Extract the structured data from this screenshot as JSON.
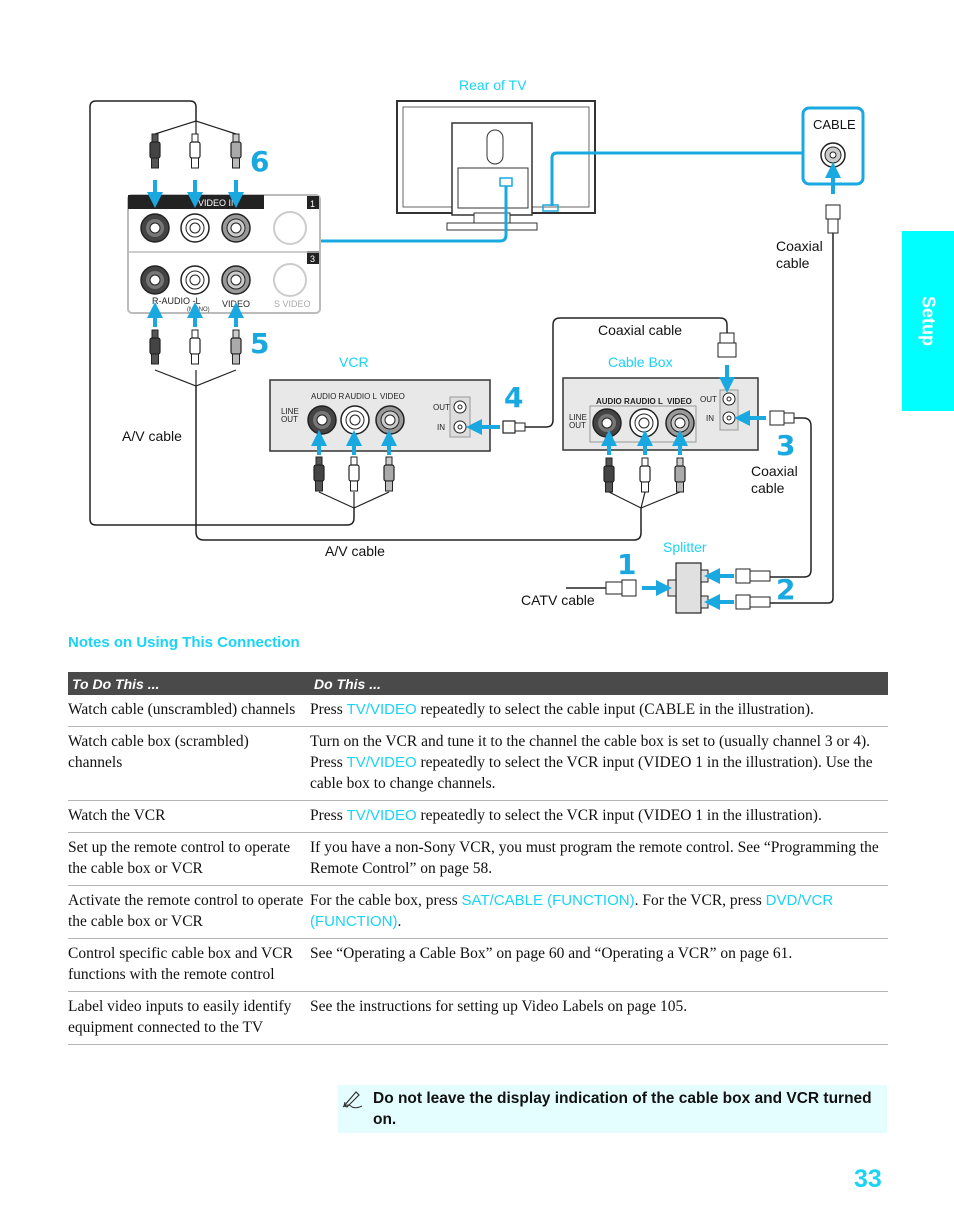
{
  "side_tab": {
    "label": "Setup"
  },
  "diagram": {
    "labels": {
      "rear_of_tv": "Rear of TV",
      "cable_jack": "CABLE",
      "coaxial_cable_top": "Coaxial cable",
      "coaxial_cable_mid": "Coaxial cable",
      "coaxial_cable_right": "Coaxial cable",
      "vcr": "VCR",
      "cable_box": "Cable Box",
      "av_cable_left": "A/V cable",
      "av_cable_bottom": "A/V cable",
      "splitter": "Splitter",
      "catv_cable": "CATV cable"
    },
    "tv_panel": {
      "video_in": "VIDEO IN",
      "input_1": "1",
      "input_3": "3",
      "r_audio_l": "R-AUDIO -L",
      "mono": "(MONO)",
      "video": "VIDEO",
      "s_video": "S VIDEO"
    },
    "vcr_panel": {
      "line_out": [
        "LINE",
        "OUT"
      ],
      "audio_r": "AUDIO R",
      "audio_l": "AUDIO L",
      "video": "VIDEO",
      "out": "OUT",
      "in": "IN"
    },
    "cablebox_panel": {
      "line_out": [
        "LINE",
        "OUT"
      ],
      "audio_r": "AUDIO R",
      "audio_l": "AUDIO L",
      "video": "VIDEO",
      "out": "OUT",
      "in": "IN"
    },
    "steps": [
      "1",
      "2",
      "3",
      "4",
      "5",
      "6"
    ]
  },
  "notes": {
    "title": "Notes on Using This Connection",
    "headers": [
      "To Do This ...",
      "Do This ..."
    ],
    "rows": [
      {
        "task": "Watch cable (unscrambled) channels",
        "action": [
          {
            "t": "Press "
          },
          {
            "t": "TV/VIDEO",
            "kw": true
          },
          {
            "t": " repeatedly to select the cable input (CABLE in the illustration)."
          }
        ]
      },
      {
        "task": "Watch cable box (scrambled) channels",
        "action": [
          {
            "t": "Turn on the VCR and tune it to the channel the cable box is set to (usually channel 3 or 4). Press "
          },
          {
            "t": "TV/VIDEO",
            "kw": true
          },
          {
            "t": " repeatedly to select the VCR input (VIDEO 1 in the illustration). Use the cable box to change channels."
          }
        ]
      },
      {
        "task": "Watch the VCR",
        "action": [
          {
            "t": "Press "
          },
          {
            "t": "TV/VIDEO",
            "kw": true
          },
          {
            "t": " repeatedly to select the VCR input (VIDEO 1 in the illustration)."
          }
        ]
      },
      {
        "task": "Set up the remote control to operate the cable box or VCR",
        "action": [
          {
            "t": "If you have a non-Sony VCR, you must program the remote control. See “Programming the Remote Control” on page 58."
          }
        ]
      },
      {
        "task": "Activate the remote control to operate the cable box or VCR",
        "action": [
          {
            "t": "For the cable box, press "
          },
          {
            "t": "SAT/CABLE (FUNCTION)",
            "kw": true
          },
          {
            "t": ". For the VCR, press "
          },
          {
            "t": "DVD/VCR (FUNCTION)",
            "kw": true
          },
          {
            "t": "."
          }
        ]
      },
      {
        "task": "Control specific cable box and VCR functions with the remote control",
        "action": [
          {
            "t": "See “Operating a Cable Box” on page 60 and “Operating a VCR” on page 61."
          }
        ]
      },
      {
        "task": "Label video inputs to easily identify equipment connected to the TV",
        "action": [
          {
            "t": "See the instructions for setting up Video Labels on page 105."
          }
        ]
      }
    ]
  },
  "tip": {
    "icon": "pencil-note-icon",
    "text": "Do not leave the display indication of the cable box and VCR turned on."
  },
  "page_number": "33",
  "colors": {
    "accent": "#1ad3f5",
    "arrow": "#1aa8e0",
    "tab": "#00ffff",
    "table_header": "#4a4a4a",
    "tip_bg": "#e4feff"
  }
}
